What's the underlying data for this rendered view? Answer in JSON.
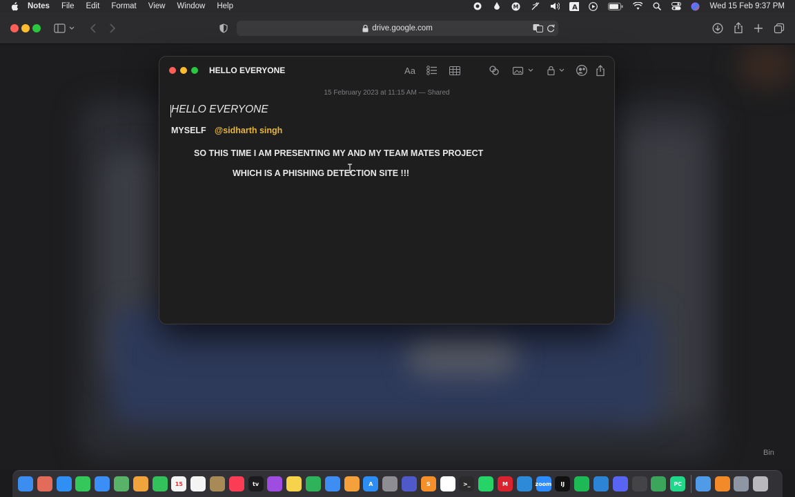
{
  "menubar": {
    "app_name": "Notes",
    "items": [
      "File",
      "Edit",
      "Format",
      "View",
      "Window",
      "Help"
    ],
    "status_icons": [
      "screen-record-icon",
      "drop-icon",
      "mail-m-icon",
      "mute-icon",
      "volume-icon",
      "input-a-icon",
      "play-icon",
      "battery-icon",
      "wifi-icon",
      "search-icon",
      "control-center-icon",
      "siri-icon"
    ],
    "input_source": "A",
    "clock": "Wed 15 Feb  9:37 PM"
  },
  "browser": {
    "url": "drive.google.com"
  },
  "notes": {
    "window_title": "HELLO EVERYONE",
    "toolbar_icons": [
      "text-format-icon",
      "checklist-icon",
      "table-icon",
      "link-icon",
      "media-icon",
      "lock-icon",
      "collaborate-icon",
      "share-icon"
    ],
    "format_label": "Aa",
    "meta": "15 February 2023 at 11:15 AM — Shared",
    "heading": "HELLO EVERYONE",
    "myself_label": "MYSELF",
    "mention": "@sidharth singh",
    "line1": "SO THIS TIME I AM PRESENTING MY AND MY TEAM MATES PROJECT",
    "line2": "WHICH IS A PHISHING DETECTION SITE !!!"
  },
  "desktop": {
    "bin_label": "Bin"
  },
  "dock": {
    "apps": [
      {
        "name": "Finder",
        "color": "#3b8ef0",
        "glyph": ""
      },
      {
        "name": "Launchpad",
        "color": "#e26b5a",
        "glyph": ""
      },
      {
        "name": "Safari",
        "color": "#2f8ff2",
        "glyph": ""
      },
      {
        "name": "Messages",
        "color": "#34c759",
        "glyph": ""
      },
      {
        "name": "Mail",
        "color": "#3a8ef5",
        "glyph": ""
      },
      {
        "name": "Maps",
        "color": "#58b368",
        "glyph": ""
      },
      {
        "name": "Photos",
        "color": "#f1a33c",
        "glyph": ""
      },
      {
        "name": "FaceTime",
        "color": "#32c15a",
        "glyph": ""
      },
      {
        "name": "Calendar",
        "color": "#f4f4f4",
        "glyph": "15"
      },
      {
        "name": "Reminders",
        "color": "#f4f4f4",
        "glyph": ""
      },
      {
        "name": "Notes-folder",
        "color": "#a88a56",
        "glyph": ""
      },
      {
        "name": "Music",
        "color": "#fa3c55",
        "glyph": ""
      },
      {
        "name": "TV",
        "color": "#1c1c1e",
        "glyph": "tv"
      },
      {
        "name": "Podcasts",
        "color": "#9f4de0",
        "glyph": ""
      },
      {
        "name": "Notes",
        "color": "#f6d34b",
        "glyph": ""
      },
      {
        "name": "Numbers",
        "color": "#2fb35a",
        "glyph": ""
      },
      {
        "name": "Keynote",
        "color": "#3d8df2",
        "glyph": ""
      },
      {
        "name": "Pages",
        "color": "#f4a13c",
        "glyph": ""
      },
      {
        "name": "App Store",
        "color": "#2c8df4",
        "glyph": "A"
      },
      {
        "name": "System Settings",
        "color": "#8d8d93",
        "glyph": ""
      },
      {
        "name": "Teams",
        "color": "#5059c9",
        "glyph": ""
      },
      {
        "name": "Sublime",
        "color": "#f48f2a",
        "glyph": "S"
      },
      {
        "name": "Chrome",
        "color": "#ffffff",
        "glyph": ""
      },
      {
        "name": "Terminal",
        "color": "#2b2b2b",
        "glyph": ">_"
      },
      {
        "name": "WhatsApp",
        "color": "#25d366",
        "glyph": ""
      },
      {
        "name": "Mendeley",
        "color": "#d9232e",
        "glyph": "M"
      },
      {
        "name": "VS Code",
        "color": "#2c8ad8",
        "glyph": ""
      },
      {
        "name": "Zoom",
        "color": "#2d8cff",
        "glyph": "zoom"
      },
      {
        "name": "IntelliJ",
        "color": "#111111",
        "glyph": "IJ"
      },
      {
        "name": "Spotify",
        "color": "#1db954",
        "glyph": ""
      },
      {
        "name": "Transmit",
        "color": "#2d84d6",
        "glyph": ""
      },
      {
        "name": "Discord",
        "color": "#5865f2",
        "glyph": ""
      },
      {
        "name": "Instruments",
        "color": "#444446",
        "glyph": ""
      },
      {
        "name": "Wiz",
        "color": "#3ba55c",
        "glyph": ""
      },
      {
        "name": "PyCharm",
        "color": "#21d789",
        "glyph": "PC"
      },
      {
        "name": "Preview",
        "color": "#4f9be8",
        "glyph": ""
      },
      {
        "name": "Books",
        "color": "#f38a2a",
        "glyph": ""
      },
      {
        "name": "Screenshot",
        "color": "#8e96a3",
        "glyph": ""
      },
      {
        "name": "Bin",
        "color": "#b9b9bd",
        "glyph": ""
      }
    ]
  }
}
